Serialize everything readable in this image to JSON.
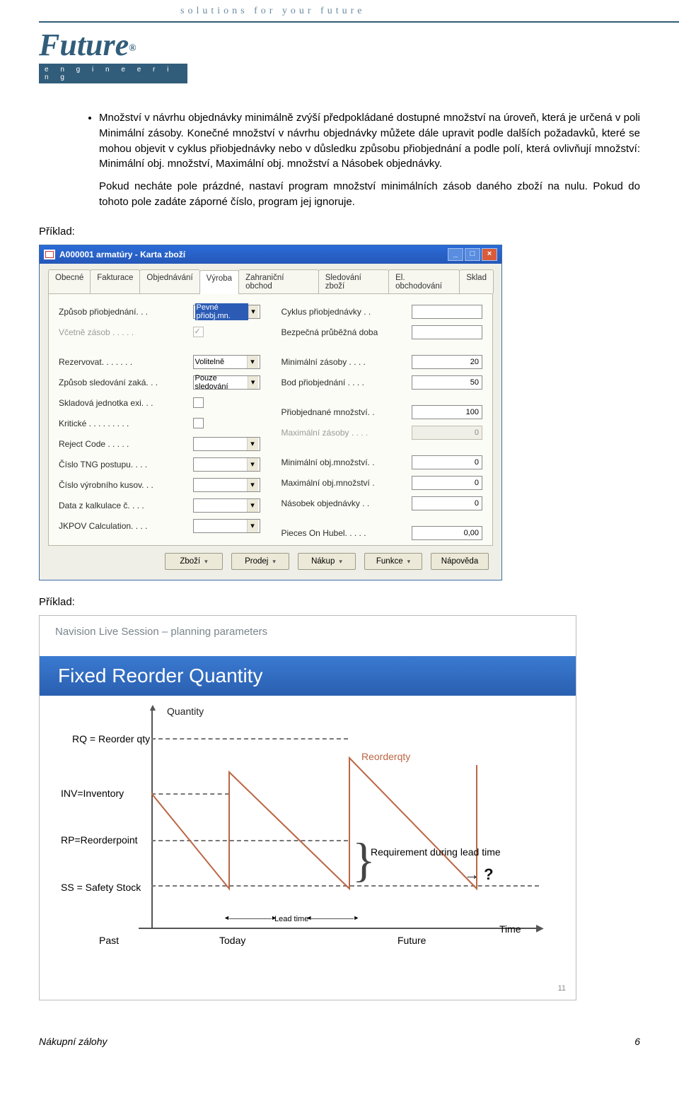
{
  "header": {
    "tagline": "solutions for your future",
    "logo_main": "Future",
    "logo_reg": "®",
    "logo_sub": "e n g i n e e r i n g"
  },
  "body": {
    "bullet1": "Množství v návrhu objednávky minimálně zvýší předpokládané dostupné množství na úroveň, která je určená v poli Minimální zásoby. Konečné množství v návrhu objednávky můžete dále upravit podle dalších požadavků, které se mohou objevit v cyklus přiobjednávky nebo v důsledku způsobu přiobjednání a podle polí, která ovlivňují množství: Minimální obj. množství, Maximální obj. množství a Násobek objednávky.",
    "bullet2": "Pokud necháte pole prázdné, nastaví program množství minimálních zásob daného zboží na nulu. Pokud do tohoto pole zadáte záporné číslo, program jej ignoruje.",
    "example_label": "Příklad:"
  },
  "nv": {
    "title": "A000001 armatúry - Karta zboží",
    "tabs": [
      "Obecné",
      "Fakturace",
      "Objednávání",
      "Výroba",
      "Zahraniční obchod",
      "Sledování zboží",
      "El. obchodování",
      "Sklad"
    ],
    "active_tab": 3,
    "left": {
      "zpusob_priobj": {
        "label": "Způsob přiobjednání. . .",
        "value": "Pevné přiobj.mn."
      },
      "vcetne_zasob": {
        "label": "Včetně zásob . . . . .",
        "checked": true,
        "disabled": true
      },
      "rezervovat": {
        "label": "Rezervovat. . . . . . .",
        "value": "Volitelně"
      },
      "zpusob_sled": {
        "label": "Způsob sledování zaká. . .",
        "value": "Pouze sledování"
      },
      "sklad_jed": {
        "label": "Skladová jednotka exi. . .",
        "checked": false
      },
      "kriticke": {
        "label": "Kritické . . . . . . . . .",
        "checked": false
      },
      "reject": {
        "label": "Reject Code . . . . .",
        "value": ""
      },
      "tng": {
        "label": "Číslo TNG postupu.  . . .",
        "value": ""
      },
      "kusov": {
        "label": "Číslo výrobního kusov. . .",
        "value": ""
      },
      "kalk": {
        "label": "Data z kalkulace č.  . . .",
        "value": ""
      },
      "jkpov": {
        "label": "JKPOV Calculation. . . .",
        "value": ""
      }
    },
    "right": {
      "cyklus": {
        "label": "Cyklus přiobjednávky . .",
        "value": ""
      },
      "bezp": {
        "label": "Bezpečná průběžná doba",
        "value": ""
      },
      "minzas": {
        "label": "Minimální zásoby . . . .",
        "value": "20"
      },
      "bod": {
        "label": "Bod přiobjednání . . . .",
        "value": "50"
      },
      "priobj": {
        "label": "Přiobjednané množství. .",
        "value": "100"
      },
      "maxzas": {
        "label": "Maximální zásoby . . . .",
        "value": "0",
        "disabled": true
      },
      "minobj": {
        "label": "Minimální obj.množství. .",
        "value": "0"
      },
      "maxobj": {
        "label": "Maximální obj.množství .",
        "value": "0"
      },
      "nasobek": {
        "label": "Násobek objednávky . .",
        "value": "0"
      },
      "pieces": {
        "label": "Pieces On Hubel. . . . .",
        "value": "0,00"
      }
    },
    "buttons": [
      "Zboží",
      "Prodej",
      "Nákup",
      "Funkce",
      "Nápověda"
    ]
  },
  "slide": {
    "top": "Navision Live Session – planning parameters",
    "title": "Fixed Reorder Quantity",
    "rq": "RQ = Reorder qty",
    "qty": "Quantity",
    "inv": "INV=Inventory",
    "rp": "RP=Reorderpoint",
    "ss": "SS = Safety Stock",
    "reorderqty": "Reorderqty",
    "req": "Requirement during lead time",
    "lead": "Lead time",
    "past": "Past",
    "today": "Today",
    "future": "Future",
    "time": "Time",
    "q": "→ ?",
    "pg": "11"
  },
  "footer": {
    "left": "Nákupní zálohy",
    "right": "6"
  }
}
